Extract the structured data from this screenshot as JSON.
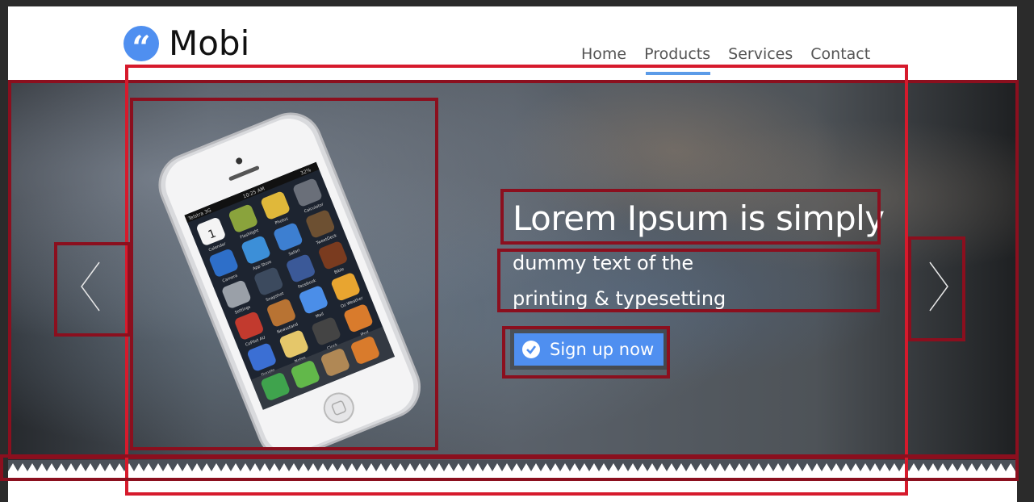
{
  "brand": {
    "name": "Mobi",
    "icon": "quote-icon",
    "color": "#4f8ff0"
  },
  "nav": {
    "items": [
      {
        "label": "Home",
        "active": false
      },
      {
        "label": "Products",
        "active": true
      },
      {
        "label": "Services",
        "active": false
      },
      {
        "label": "Contact",
        "active": false
      }
    ],
    "active_color": "#5b9be8"
  },
  "hero": {
    "title": "Lorem Ipsum is simply",
    "subtitle_line1": "dummy text of the",
    "subtitle_line2": "printing & typesetting",
    "cta_label": "Sign up now",
    "cta_icon": "check-circle-icon",
    "prev_icon": "chevron-left-icon",
    "next_icon": "chevron-right-icon",
    "image": "iphone-photo"
  },
  "phone": {
    "carrier": "Telstra 3G",
    "time": "10:25 AM",
    "battery": "32%",
    "apps": [
      "Calendar",
      "Flashlight",
      "Photos",
      "Calculator",
      "Camera",
      "App Store",
      "Safari",
      "TweetDeck",
      "Settings",
      "Snapshot",
      "Facebook",
      "Bible",
      "CoPilot AU",
      "Newsstand",
      "Mail",
      "Oz Weather",
      "Google",
      "Notes",
      "Clock",
      "iPod"
    ],
    "dock": [
      "Phone",
      "Messages",
      "Contacts",
      "iPod"
    ],
    "calendar_day": "1"
  },
  "colors": {
    "annotation_dark": "#8b0f1e",
    "annotation_bright": "#d61a2c",
    "accent": "#4f8ff0"
  }
}
